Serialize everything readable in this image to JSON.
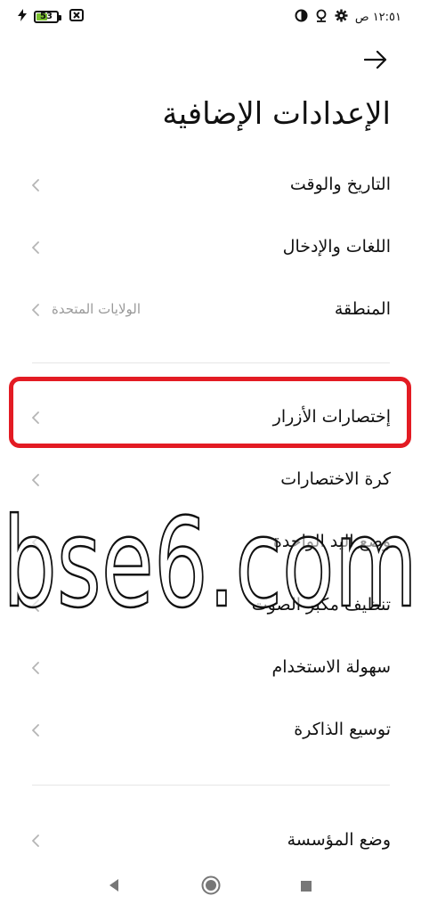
{
  "status_bar": {
    "time": "١٢:٥١ ص",
    "battery_level": "53",
    "battery_fill_percent": 53,
    "icons": [
      "charging-bolt-icon",
      "battery-icon",
      "sim-off-icon",
      "gear-icon",
      "location-icon",
      "data-saver-icon"
    ]
  },
  "header": {
    "back_icon": "arrow-right-icon",
    "title": "الإعدادات الإضافية"
  },
  "items": [
    {
      "label": "التاريخ والوقت",
      "value": ""
    },
    {
      "label": "اللغات والإدخال",
      "value": ""
    },
    {
      "label": "المنطقة",
      "value": "الولايات المتحدة"
    },
    {
      "label": "إختصارات الأزرار",
      "value": ""
    },
    {
      "label": "كرة الاختصارات",
      "value": ""
    },
    {
      "label": "وضع اليد الواحدة",
      "value": ""
    },
    {
      "label": "تنظيف مكبر الصوت",
      "value": ""
    },
    {
      "label": "سهولة الاستخدام",
      "value": ""
    },
    {
      "label": "توسيع الذاكرة",
      "value": ""
    },
    {
      "label": "وضع المؤسسة",
      "value": ""
    }
  ],
  "watermark": {
    "text": "bse6.com"
  },
  "nav_bar": {
    "icons": [
      "back-triangle-icon",
      "home-circle-icon",
      "recents-square-icon"
    ]
  },
  "colors": {
    "highlight": "#e31b23",
    "battery_fill": "#79c02e",
    "secondary_text": "#9a9a9a",
    "divider": "#e6e6e6"
  }
}
